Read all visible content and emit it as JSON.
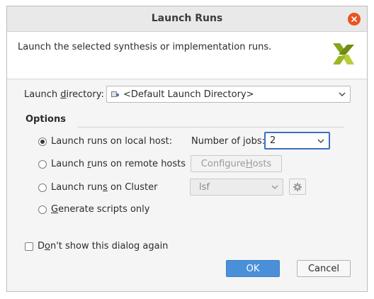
{
  "window": {
    "title": "Launch Runs"
  },
  "header": {
    "description": "Launch the selected synthesis or implementation runs."
  },
  "launch_directory": {
    "label_pre": "Launch ",
    "label_mnemonic": "d",
    "label_post": "irectory:",
    "value": "<Default Launch Directory>",
    "icon": "folder-icon"
  },
  "options": {
    "title": "Options",
    "local_host": {
      "label": "Launch runs on local host:",
      "checked": true,
      "jobs_label": "Number of jobs:",
      "jobs_value": "2"
    },
    "remote_hosts": {
      "label_pre": "Launch ",
      "label_mnemonic": "r",
      "label_post": "uns on remote hosts",
      "checked": false,
      "configure_pre": "Configure ",
      "configure_mnemonic": "H",
      "configure_post": "osts"
    },
    "cluster": {
      "label_pre": "Launch run",
      "label_mnemonic": "s",
      "label_post": " on Cluster",
      "checked": false,
      "cluster_value": "lsf",
      "settings_icon": "gear-icon"
    },
    "scripts": {
      "label_mnemonic": "G",
      "label_post": "enerate scripts only",
      "checked": false
    }
  },
  "dont_show": {
    "label_pre": "D",
    "label_mnemonic": "o",
    "label_post": "n't show this dialog again",
    "checked": false
  },
  "buttons": {
    "ok": "OK",
    "cancel": "Cancel"
  },
  "colors": {
    "accent_close": "#e95420",
    "primary_button": "#4a90d9",
    "focus_border": "#3b6fc4"
  }
}
